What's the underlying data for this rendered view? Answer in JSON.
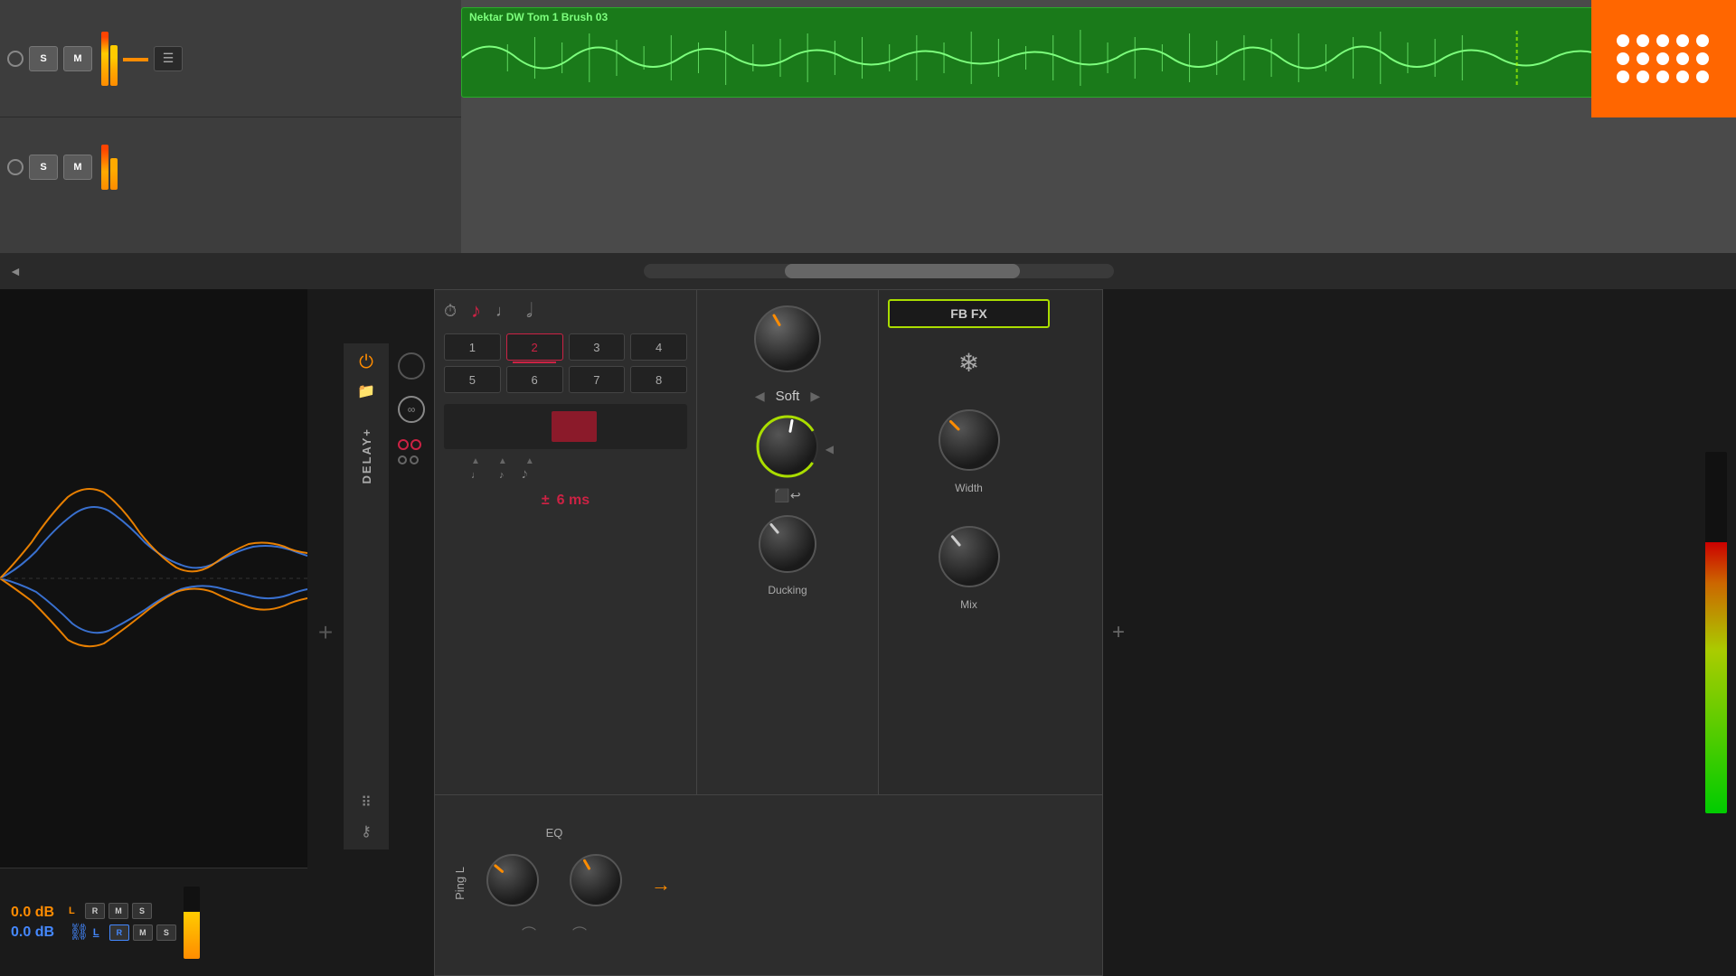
{
  "daw": {
    "track1": {
      "clip_name": "Nektar DW Tom 1 Brush 03",
      "s_label": "S",
      "m_label": "M"
    },
    "track2": {
      "s_label": "S",
      "m_label": "M"
    }
  },
  "plugin": {
    "name": "DELAY+",
    "power_on": true,
    "fb_fx_label": "FB FX",
    "soft_label": "Soft",
    "numbers": [
      "1",
      "2",
      "3",
      "4",
      "5",
      "6",
      "7",
      "8"
    ],
    "active_number": "2",
    "ms_value": "6 ms",
    "ms_symbol": "±",
    "eq_label": "EQ",
    "ping_label": "Ping L",
    "knobs": {
      "main": {
        "label": "",
        "rotation": -30
      },
      "width": {
        "label": "Width",
        "rotation": -45
      },
      "ducking": {
        "label": "Ducking",
        "rotation": -60
      },
      "mix": {
        "label": "Mix",
        "rotation": -40
      },
      "eq1": {
        "label": "",
        "rotation": -50
      },
      "eq2": {
        "label": "",
        "rotation": -30
      }
    }
  },
  "meters": {
    "orange_db": "0.0 dB",
    "blue_db": "0.0 dB",
    "l_label": "L",
    "r_label": "R",
    "m_label": "M",
    "s_label": "S"
  },
  "icons": {
    "power": "⏻",
    "folder": "🗁",
    "dots": "⠿",
    "key": "⚷",
    "freeze": "❄",
    "clock": "⏱",
    "plus": "+",
    "arrow_left": "◀",
    "arrow_right": "▶",
    "arrow_left_scroll": "◄"
  }
}
